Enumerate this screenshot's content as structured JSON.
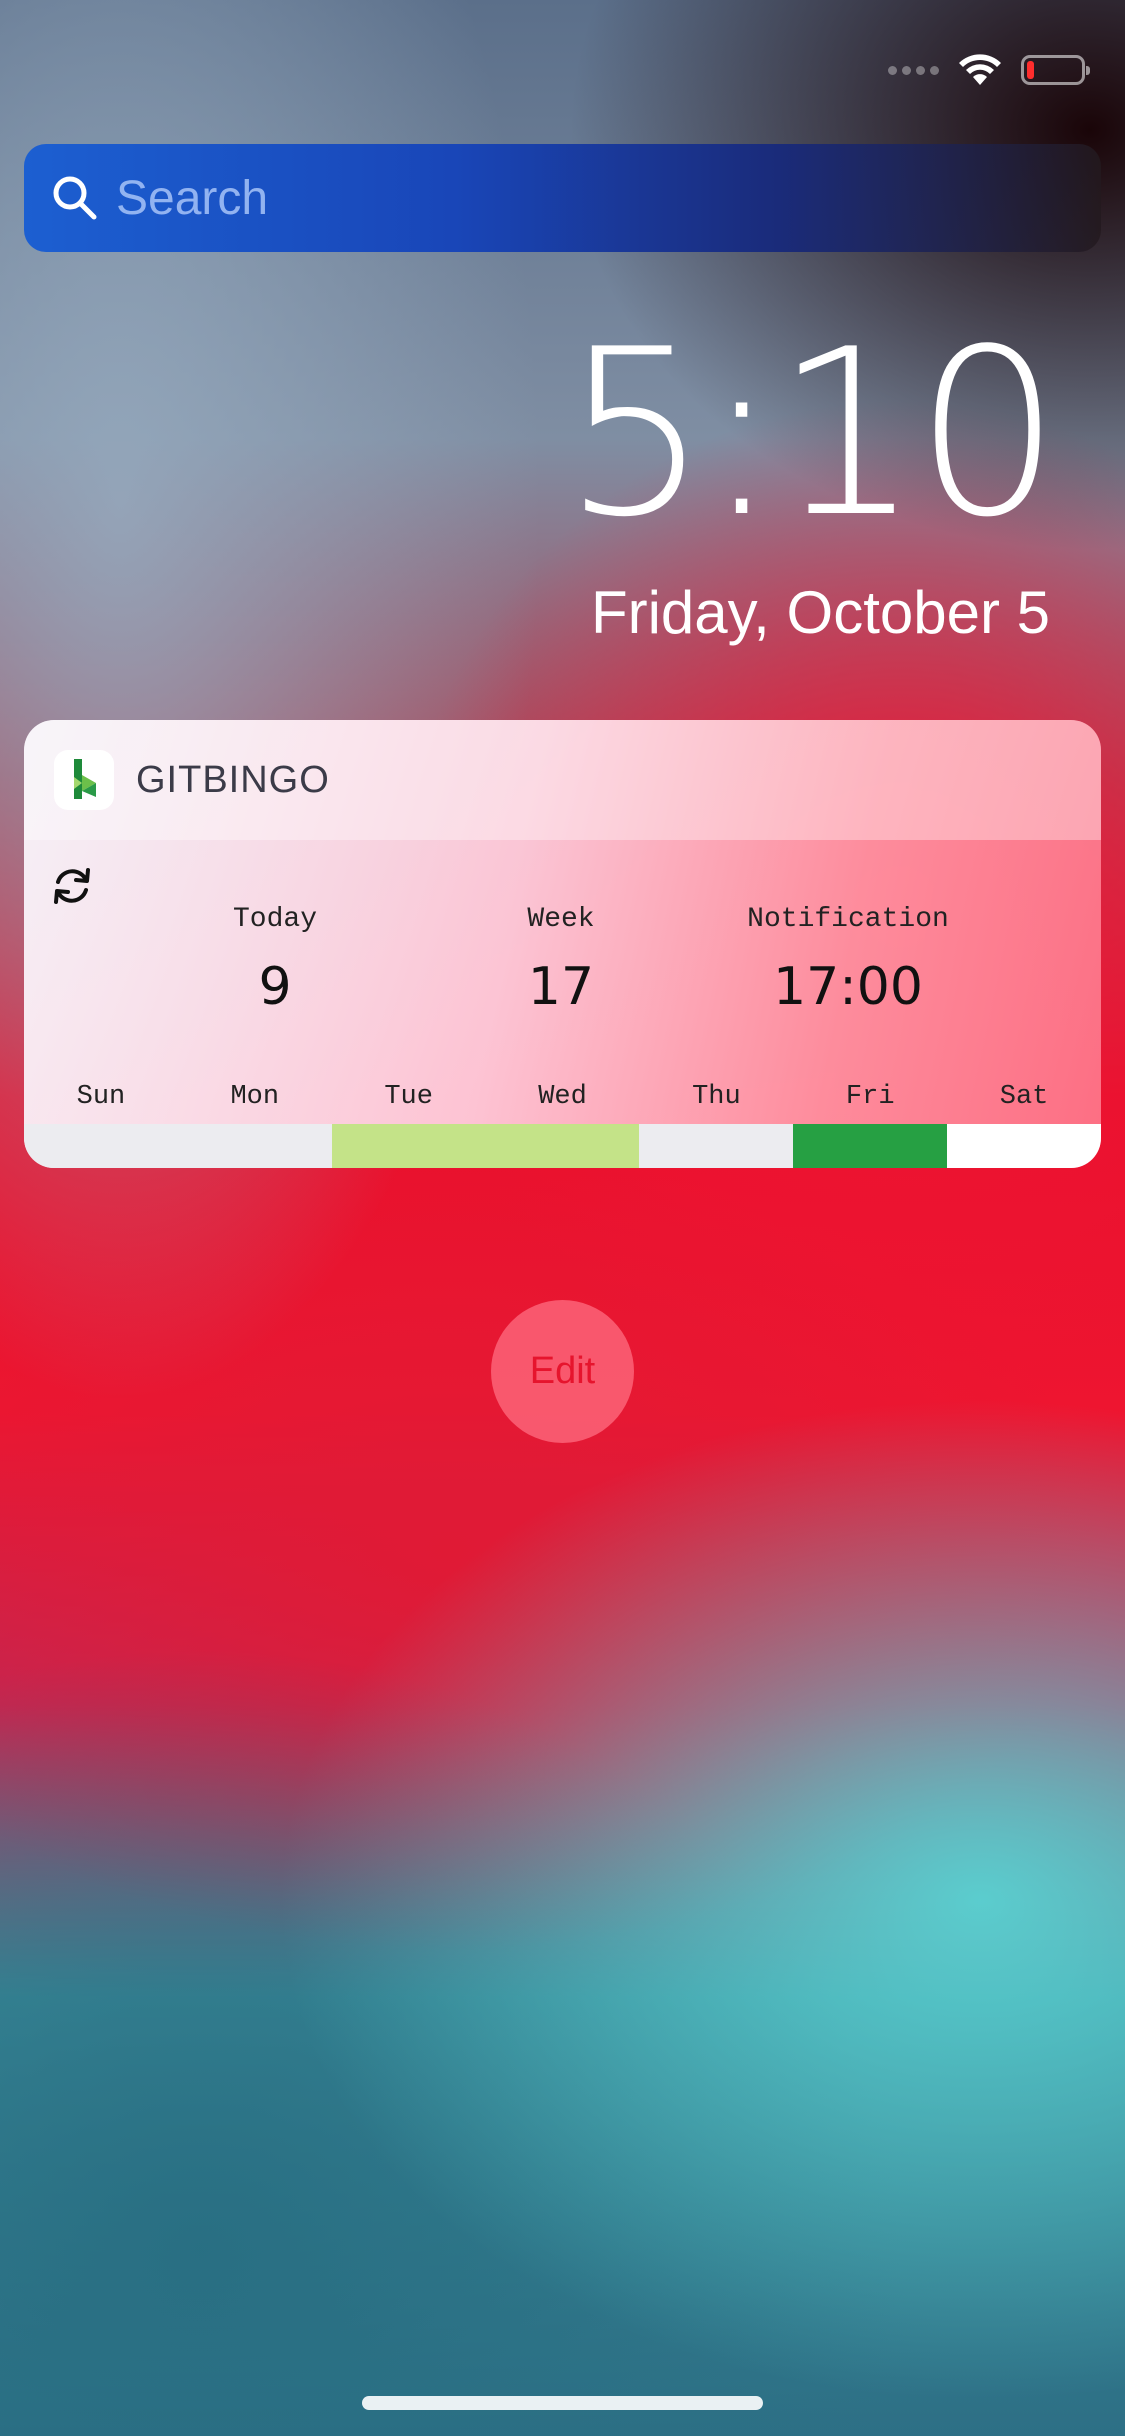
{
  "status_bar": {
    "signal_icon": "cellular-signal-dots-icon",
    "wifi_icon": "wifi-icon",
    "battery_icon": "battery-low-icon",
    "battery_color": "#ff2d2d"
  },
  "search": {
    "placeholder": "Search",
    "icon": "search-icon"
  },
  "lock_screen": {
    "time": "5:10",
    "date": "Friday, October 5"
  },
  "widget": {
    "app_name": "GITBINGO",
    "app_icon": "gitbingo-logo-icon",
    "refresh_icon": "refresh-icon",
    "stats": [
      {
        "label": "Today",
        "value": "9"
      },
      {
        "label": "Week",
        "value": "17"
      },
      {
        "label": "Notification",
        "value": "17:00"
      }
    ],
    "days": [
      "Sun",
      "Mon",
      "Tue",
      "Wed",
      "Thu",
      "Fri",
      "Sat"
    ],
    "day_colors": [
      "#ececf0",
      "#ececf0",
      "#c4e388",
      "#c4e388",
      "#ececf0",
      "#26a043",
      "#ffffff"
    ]
  },
  "edit_button": {
    "label": "Edit"
  }
}
